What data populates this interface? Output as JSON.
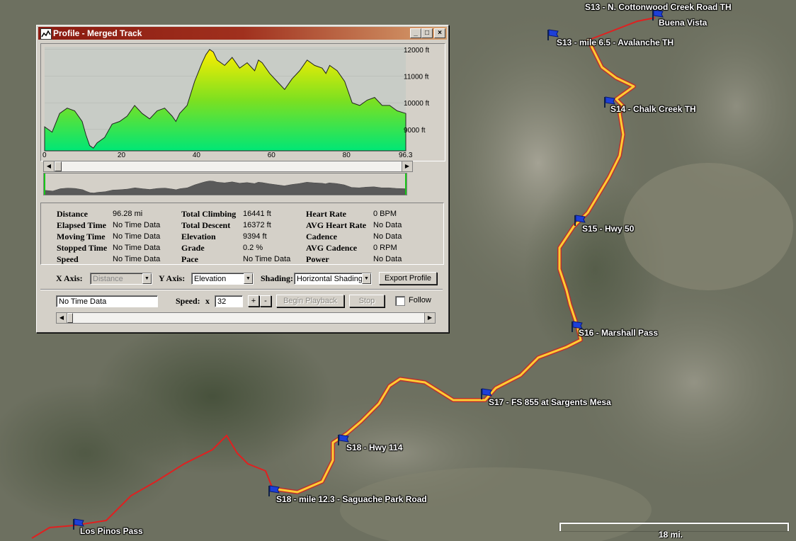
{
  "colors": {
    "track_selected": "#ffcc33",
    "track_other": "#e02020",
    "title_start": "#8a1a10",
    "title_end": "#d7a06e"
  },
  "map": {
    "waypoints": [
      "S13 - N. Cottonwood Creek Road TH",
      "Buena Vista",
      "S13 - mile 6.5 - Avalanche TH",
      "S14 - Chalk Creek TH",
      "S15 - Hwy 50",
      "S16 - Marshall Pass",
      "S17 - FS 855 at Sargents Mesa",
      "S18 - Hwy 114",
      "S18 - mile 12.3 - Saguache Park Road",
      "Los Pinos Pass"
    ],
    "scale_label": "18 mi.",
    "icons": [
      "flag-icon"
    ]
  },
  "window": {
    "title": "Profile - Merged Track",
    "controls": {
      "minimize": "_",
      "maximize": "□",
      "close": "×"
    }
  },
  "chart_data": {
    "type": "area",
    "x_ticks": [
      "0",
      "20",
      "40",
      "60",
      "80",
      "96.3"
    ],
    "y_ticks": [
      "12000 ft",
      "11000 ft",
      "10000 ft",
      "9000 ft"
    ],
    "xlim": [
      0,
      96.3
    ],
    "ylim": [
      8200,
      12100
    ],
    "shading": "horizontal gradient green to yellow",
    "series": [
      {
        "x": [
          0,
          2,
          4,
          6,
          8,
          10,
          11,
          12,
          13,
          14,
          16,
          18,
          20,
          22,
          24,
          26,
          28,
          30,
          32,
          34,
          35,
          36,
          38,
          40,
          42,
          43,
          44,
          45,
          46,
          48,
          50,
          52,
          54,
          56,
          57,
          58,
          60,
          62,
          64,
          66,
          68,
          70,
          72,
          74,
          75,
          76,
          78,
          80,
          82,
          84,
          86,
          88,
          90,
          92,
          94,
          96.3
        ],
        "y": [
          9100,
          8900,
          9600,
          9800,
          9700,
          9300,
          8800,
          8400,
          8300,
          8500,
          8700,
          9200,
          9300,
          9500,
          9900,
          9600,
          9400,
          9700,
          9800,
          9500,
          9300,
          9600,
          9900,
          10800,
          11500,
          11800,
          12000,
          11900,
          11600,
          11400,
          11700,
          11300,
          11500,
          11200,
          11600,
          11500,
          11100,
          10800,
          10500,
          10900,
          11200,
          11600,
          11400,
          11300,
          11100,
          11400,
          11200,
          10800,
          10000,
          9900,
          10100,
          10200,
          9900,
          9900,
          9700,
          9600
        ]
      }
    ]
  },
  "stats": [
    [
      {
        "label": "Distance",
        "value": "96.28 mi"
      },
      {
        "label": "Total Climbing",
        "value": "16441 ft"
      },
      {
        "label": "Heart Rate",
        "value": "0 BPM"
      }
    ],
    [
      {
        "label": "Elapsed Time",
        "value": "No Time Data"
      },
      {
        "label": "Total Descent",
        "value": "16372 ft"
      },
      {
        "label": "AVG Heart Rate",
        "value": "No Data"
      }
    ],
    [
      {
        "label": "Moving Time",
        "value": "No Time Data"
      },
      {
        "label": "Elevation",
        "value": "9394 ft"
      },
      {
        "label": "Cadence",
        "value": "No Data"
      }
    ],
    [
      {
        "label": "Stopped Time",
        "value": "No Time Data"
      },
      {
        "label": "Grade",
        "value": "0.2 %"
      },
      {
        "label": "AVG Cadence",
        "value": "0 RPM"
      }
    ],
    [
      {
        "label": "Speed",
        "value": "No Time Data"
      },
      {
        "label": "Pace",
        "value": "No Time Data"
      },
      {
        "label": "Power",
        "value": "No Data"
      }
    ]
  ],
  "controls": {
    "x_axis_label": "X Axis:",
    "x_axis_value": "Distance",
    "y_axis_label": "Y Axis:",
    "y_axis_value": "Elevation",
    "shading_label": "Shading:",
    "shading_value": "Horizontal Shading",
    "export_button": "Export Profile"
  },
  "playback": {
    "time_value": "No Time Data",
    "speed_label": "Speed:",
    "speed_x": "x",
    "speed_value": "32",
    "plus": "+",
    "minus": "-",
    "begin_button": "Begin Playback",
    "stop_button": "Stop",
    "follow_label": "Follow"
  }
}
